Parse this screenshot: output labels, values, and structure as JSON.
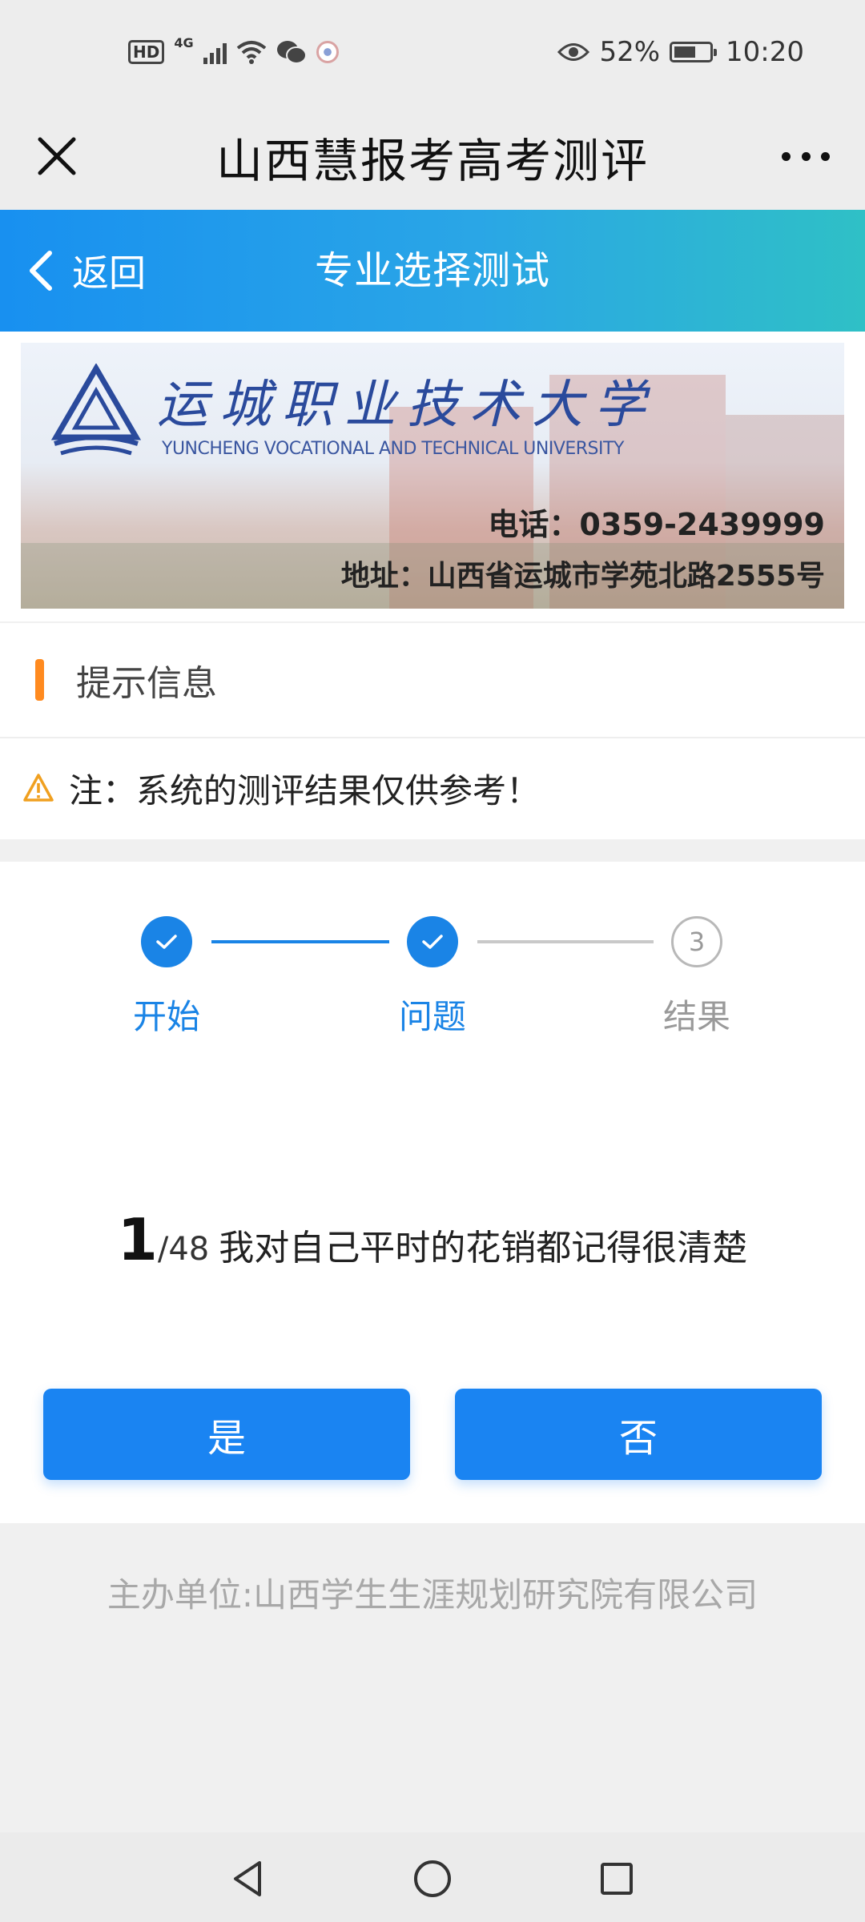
{
  "status_bar": {
    "hd": "HD",
    "network": "4G",
    "battery": "52%",
    "time": "10:20",
    "icons": [
      "hd-icon",
      "signal-icon",
      "wifi-icon",
      "wechat-icon",
      "app-icon",
      "eye-icon",
      "battery-icon"
    ]
  },
  "wechat_nav": {
    "title": "山西慧报考高考测评",
    "close_icon": "close-icon",
    "more_icon": "more-icon"
  },
  "header": {
    "back_label": "返回",
    "title": "专业选择测试",
    "gradient": [
      "#1890f0",
      "#2fc0c6"
    ]
  },
  "banner": {
    "school_name": "运城职业技术大学",
    "school_name_en": "YUNCHENG VOCATIONAL AND TECHNICAL UNIVERSITY",
    "phone": "电话：0359-2439999",
    "address": "地址：山西省运城市学苑北路2555号"
  },
  "tips": {
    "title": "提示信息",
    "text": "注：系统的测评结果仅供参考！",
    "accent": "#ff8a1f"
  },
  "steps": {
    "items": [
      {
        "label": "开始",
        "state": "done"
      },
      {
        "label": "问题",
        "state": "done"
      },
      {
        "label": "结果",
        "state": "todo",
        "number": "3"
      }
    ],
    "active_color": "#1a84e6",
    "inactive_color": "#9a9a9a"
  },
  "question": {
    "index": "1",
    "total": "/48",
    "text": "我对自己平时的花销都记得很清楚"
  },
  "answers": {
    "yes": "是",
    "no": "否",
    "color": "#1a84f2"
  },
  "footer": {
    "text": "主办单位:山西学生生涯规划研究院有限公司"
  },
  "android_nav": {
    "icons": [
      "back-triangle-icon",
      "home-circle-icon",
      "recents-square-icon"
    ]
  }
}
